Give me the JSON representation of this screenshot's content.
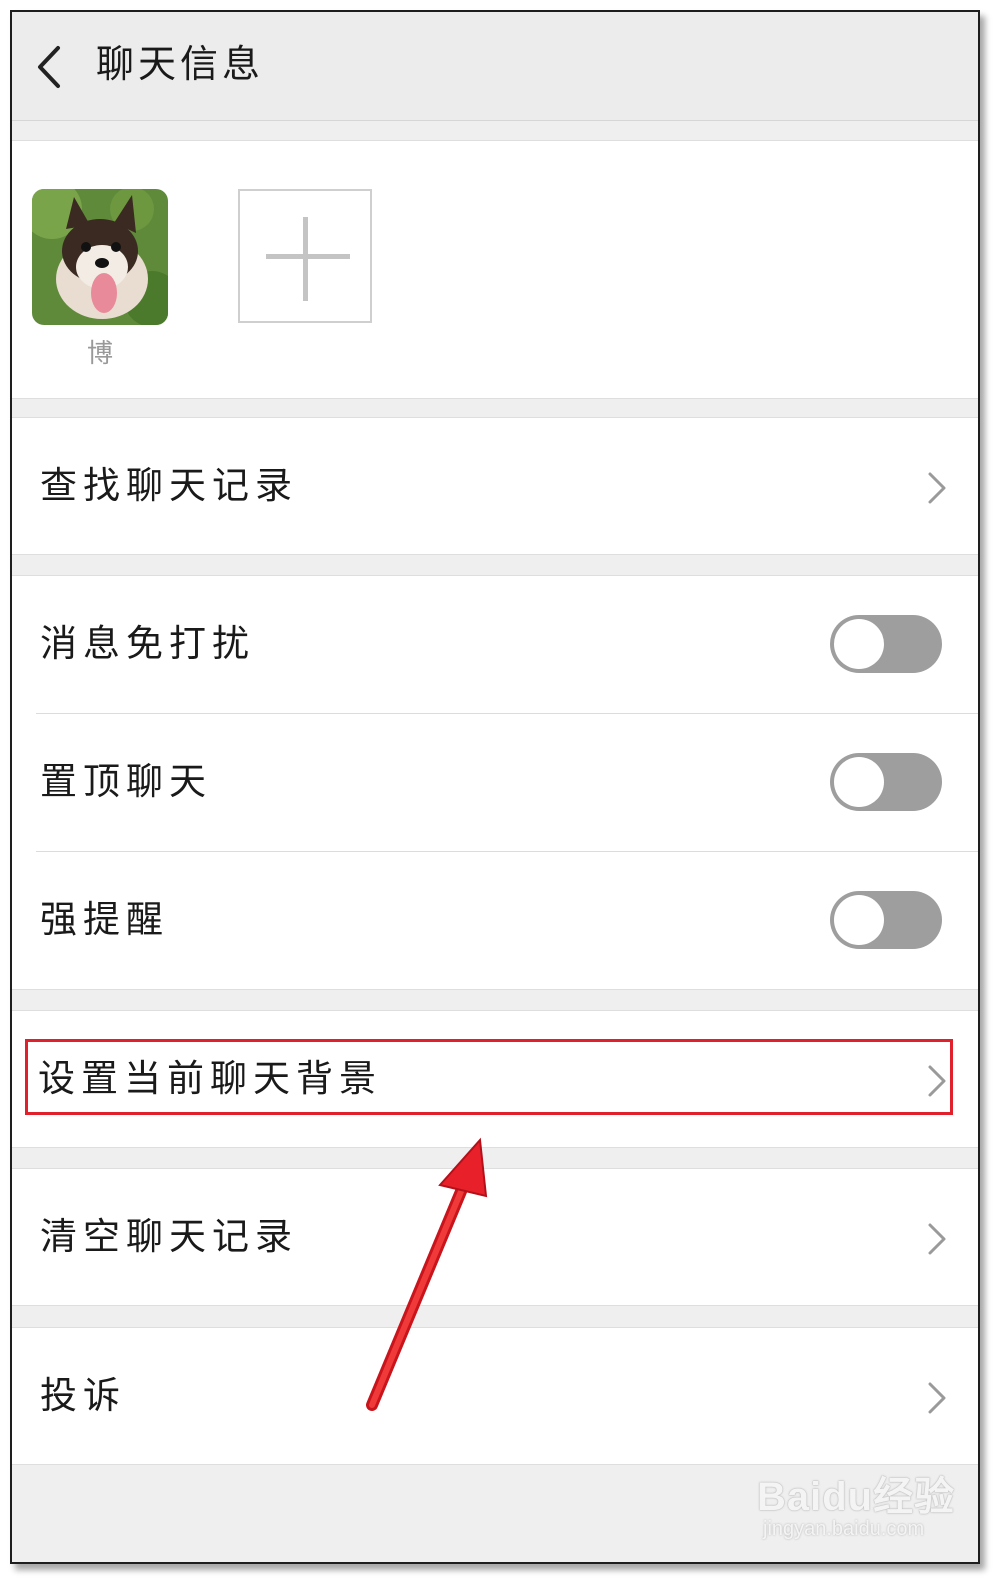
{
  "header": {
    "title": "聊天信息",
    "back_icon": "chevron-left-icon"
  },
  "members": {
    "items": [
      {
        "name": "博",
        "avatar": "dog-photo"
      }
    ],
    "add_icon": "plus-icon"
  },
  "sections": {
    "search_history": {
      "label": "查找聊天记录"
    },
    "mute": {
      "label": "消息免打扰",
      "on": false
    },
    "sticky": {
      "label": "置顶聊天",
      "on": false
    },
    "strong_remind": {
      "label": "强提醒",
      "on": false
    },
    "chat_background": {
      "label": "设置当前聊天背景"
    },
    "clear_history": {
      "label": "清空聊天记录"
    },
    "report": {
      "label": "投诉"
    }
  },
  "annotation": {
    "highlight_color": "#e0202a"
  },
  "watermark": {
    "brand": "Baidu经验",
    "url": "jingyan.baidu.com"
  }
}
